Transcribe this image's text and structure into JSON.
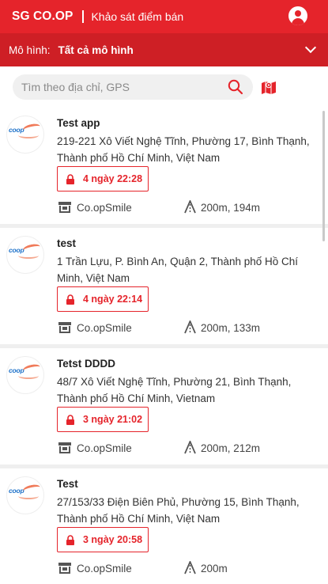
{
  "header": {
    "brand": "SG CO.OP",
    "subtitle": "Khảo sát điểm bán",
    "account_icon": "user-circle-icon"
  },
  "model_filter": {
    "label": "Mô hình:",
    "value": "Tất cả mô hình"
  },
  "search": {
    "placeholder": "Tìm theo địa chỉ, GPS"
  },
  "colors": {
    "primary": "#e5242b",
    "primary_dark": "#ce1f25"
  },
  "locations": [
    {
      "title": "Test app",
      "address": "219-221 Xô Viết Nghệ Tĩnh, Phường 17, Bình Thạnh, Thành phố Hồ Chí Minh, Việt Nam",
      "timer": "4 ngày 22:28",
      "store": "Co.opSmile",
      "distance": "200m, 194m"
    },
    {
      "title": "test",
      "address": "1 Trần Lựu, P. Bình An, Quận 2, Thành phố Hồ Chí Minh, Việt Nam",
      "timer": "4 ngày 22:14",
      "store": "Co.opSmile",
      "distance": "200m, 133m"
    },
    {
      "title": "Tetst DDDD",
      "address": "48/7 Xô Viết Nghệ Tĩnh, Phường 21, Bình Thạnh, Thành phố Hồ Chí Minh, Vietnam",
      "timer": "3 ngày 21:02",
      "store": "Co.opSmile",
      "distance": "200m, 212m"
    },
    {
      "title": "Test",
      "address": "27/153/33 Điện Biên Phủ, Phường 15, Bình Thạnh, Thành phố Hồ Chí Minh, Việt Nam",
      "timer": "3 ngày 20:58",
      "store": "Co.opSmile",
      "distance": "200m"
    }
  ]
}
